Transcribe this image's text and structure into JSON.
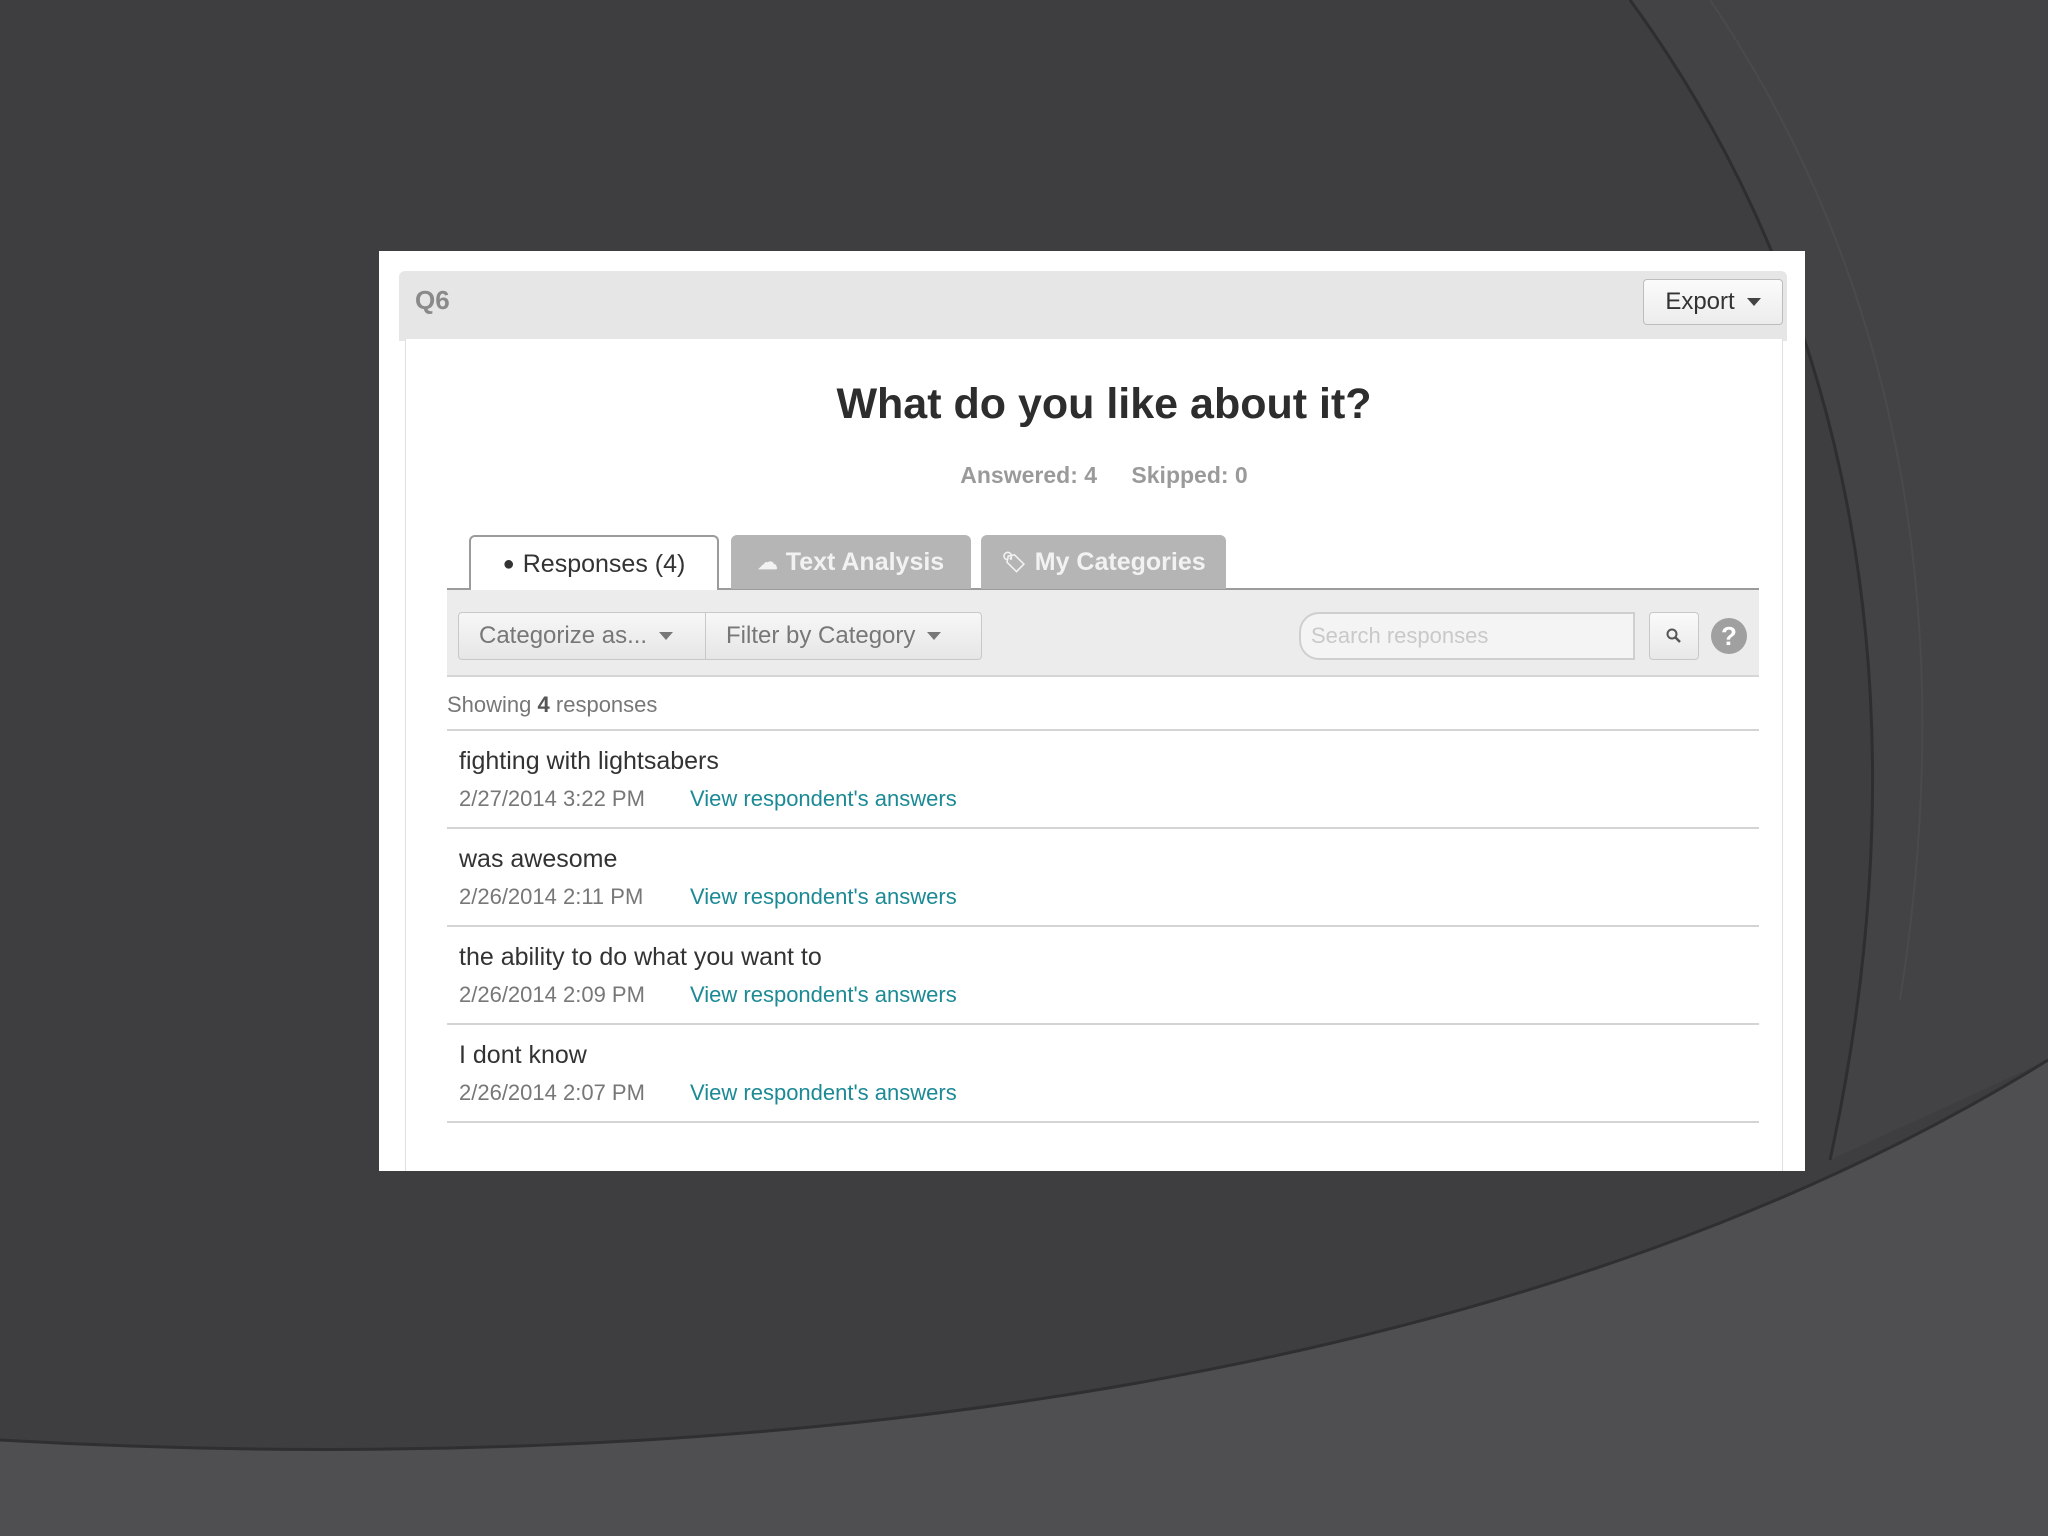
{
  "question": {
    "number": "Q6",
    "title": "What do you like about it?",
    "answered": "Answered: 4",
    "skipped": "Skipped: 0"
  },
  "header": {
    "export_label": "Export"
  },
  "tabs": [
    {
      "label": "Responses (4)",
      "icon": "speech-bubble-icon",
      "active": true
    },
    {
      "label": "Text Analysis",
      "icon": "cloud-icon",
      "active": false
    },
    {
      "label": "My Categories",
      "icon": "tag-icon",
      "active": false
    }
  ],
  "toolbar": {
    "categorize_label": "Categorize as...",
    "filter_label": "Filter by Category",
    "search_placeholder": "Search responses",
    "help_label": "?"
  },
  "showing": {
    "prefix": "Showing",
    "count": "4",
    "suffix": "responses"
  },
  "responses": [
    {
      "text": "fighting with lightsabers",
      "date": "2/27/2014 3:22 PM",
      "link": "View respondent's answers"
    },
    {
      "text": "was awesome",
      "date": "2/26/2014 2:11 PM",
      "link": "View respondent's answers"
    },
    {
      "text": "the ability to do what you want to",
      "date": "2/26/2014 2:09 PM",
      "link": "View respondent's answers"
    },
    {
      "text": "I dont know",
      "date": "2/26/2014 2:07 PM",
      "link": "View respondent's answers"
    }
  ],
  "colors": {
    "link": "#1b8a95",
    "tab_inactive": "#b5b5b5",
    "background": "#3e3e40"
  }
}
